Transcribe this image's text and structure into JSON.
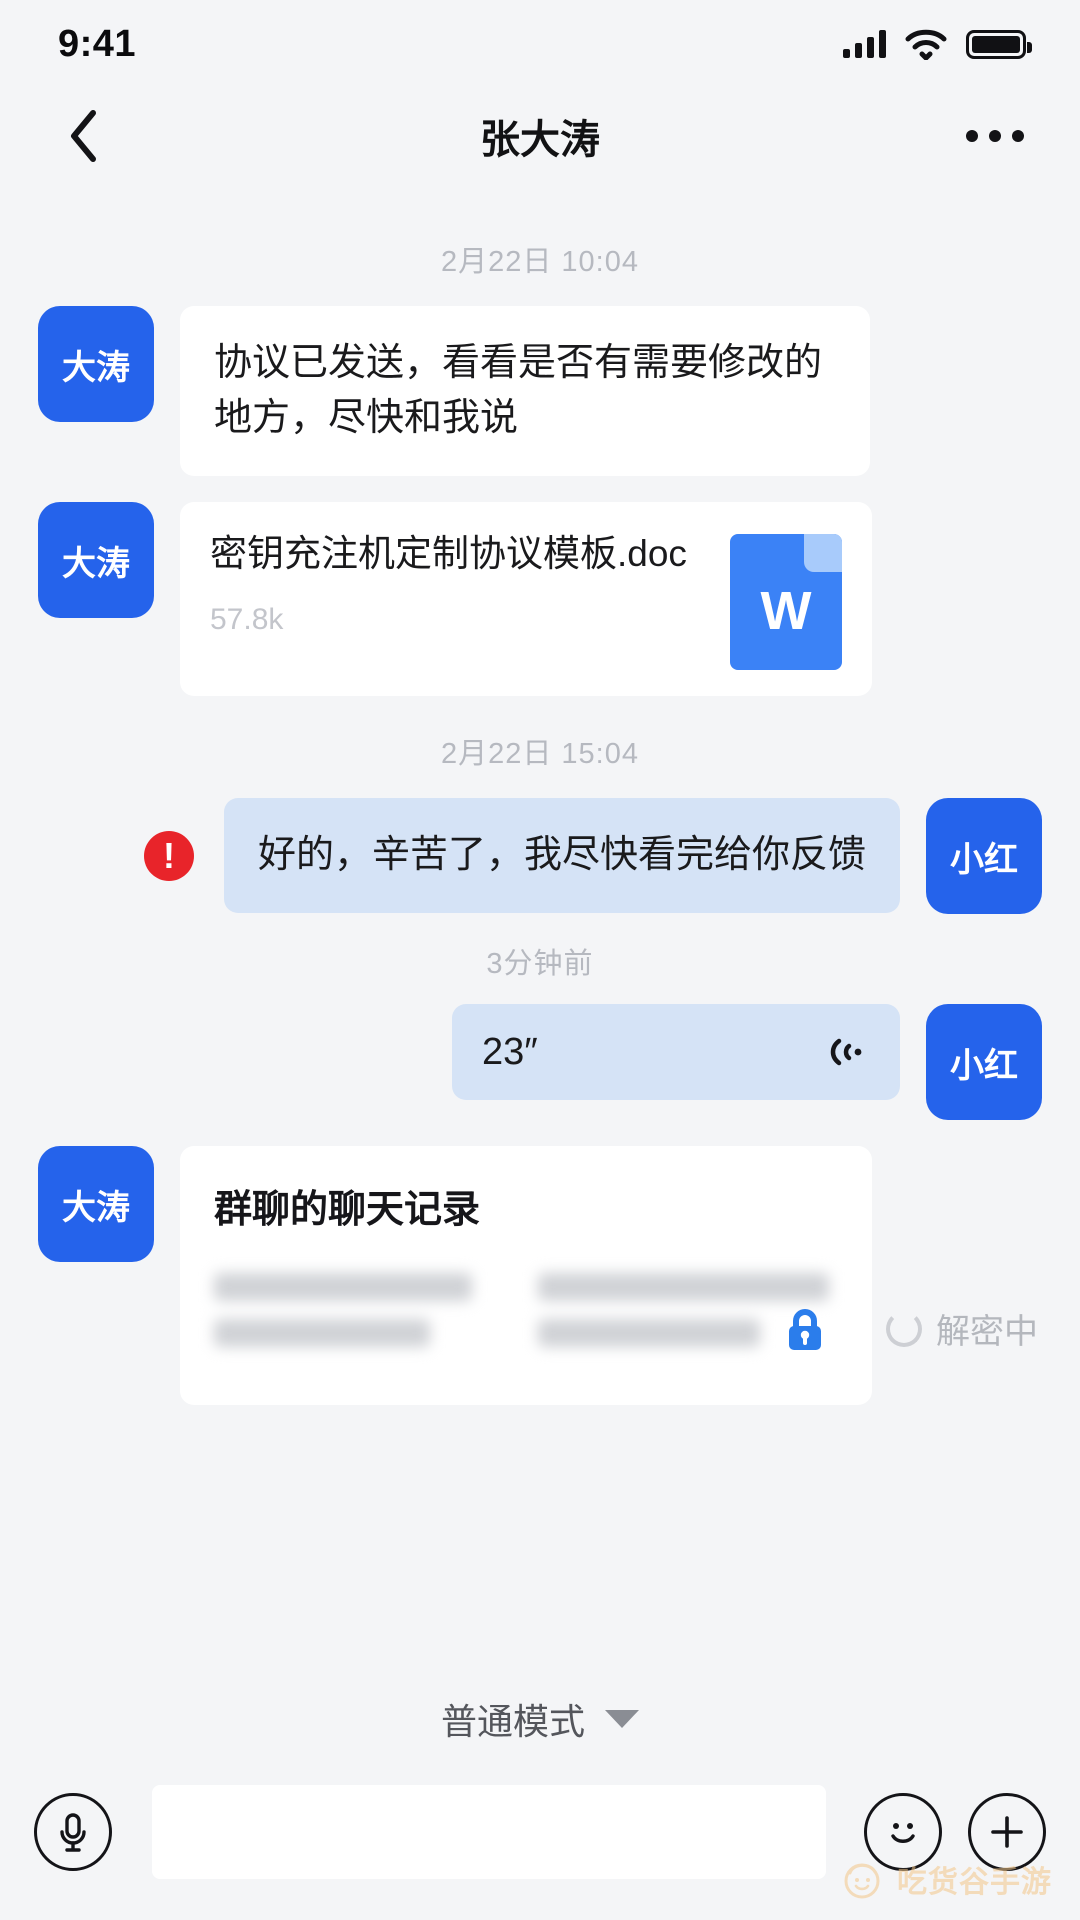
{
  "status_bar": {
    "time": "9:41",
    "signal_icon": "signal-bars-icon",
    "wifi_icon": "wifi-icon",
    "battery_icon": "battery-full-icon"
  },
  "header": {
    "back_icon": "chevron-left-icon",
    "title": "张大涛",
    "more_icon": "more-options-icon"
  },
  "messages": [
    {
      "timestamp": "2月22日 10:04",
      "side": "in",
      "avatar": "大涛",
      "type": "text",
      "text": "协议已发送，看看是否有需要修改的地方，尽快和我说"
    },
    {
      "side": "in",
      "avatar": "大涛",
      "type": "file",
      "file_name": "密钥充注机定制协议模板.doc",
      "file_size": "57.8k",
      "file_icon_letter": "W"
    },
    {
      "timestamp": "2月22日 15:04",
      "side": "out",
      "avatar": "小红",
      "type": "text",
      "text": "好的，辛苦了，我尽快看完给你反馈",
      "error_badge": "!"
    },
    {
      "timestamp": "3分钟前",
      "side": "out",
      "avatar": "小红",
      "type": "voice",
      "duration": "23″",
      "voice_icon": "sound-wave-icon"
    },
    {
      "side": "in",
      "avatar": "大涛",
      "type": "chat_record",
      "title": "群聊的聊天记录",
      "lock_icon": "lock-icon",
      "status_text": "解密中",
      "spinner_icon": "loading-spinner-icon"
    }
  ],
  "footer": {
    "mode_label": "普通模式",
    "mode_caret_icon": "chevron-down-icon",
    "mic_icon": "microphone-icon",
    "input_placeholder": "",
    "input_value": "",
    "emoji_icon": "smiley-icon",
    "plus_icon": "plus-icon"
  },
  "watermark": {
    "logo_icon": "face-logo-icon",
    "text": "吃货谷手游"
  },
  "colors": {
    "accent_blue": "#2563EB",
    "bubble_out": "#D5E3F6",
    "bubble_in": "#FFFFFF",
    "error_red": "#E8242A",
    "page_bg": "#F4F5F7",
    "watermark": "#F3C68A"
  }
}
